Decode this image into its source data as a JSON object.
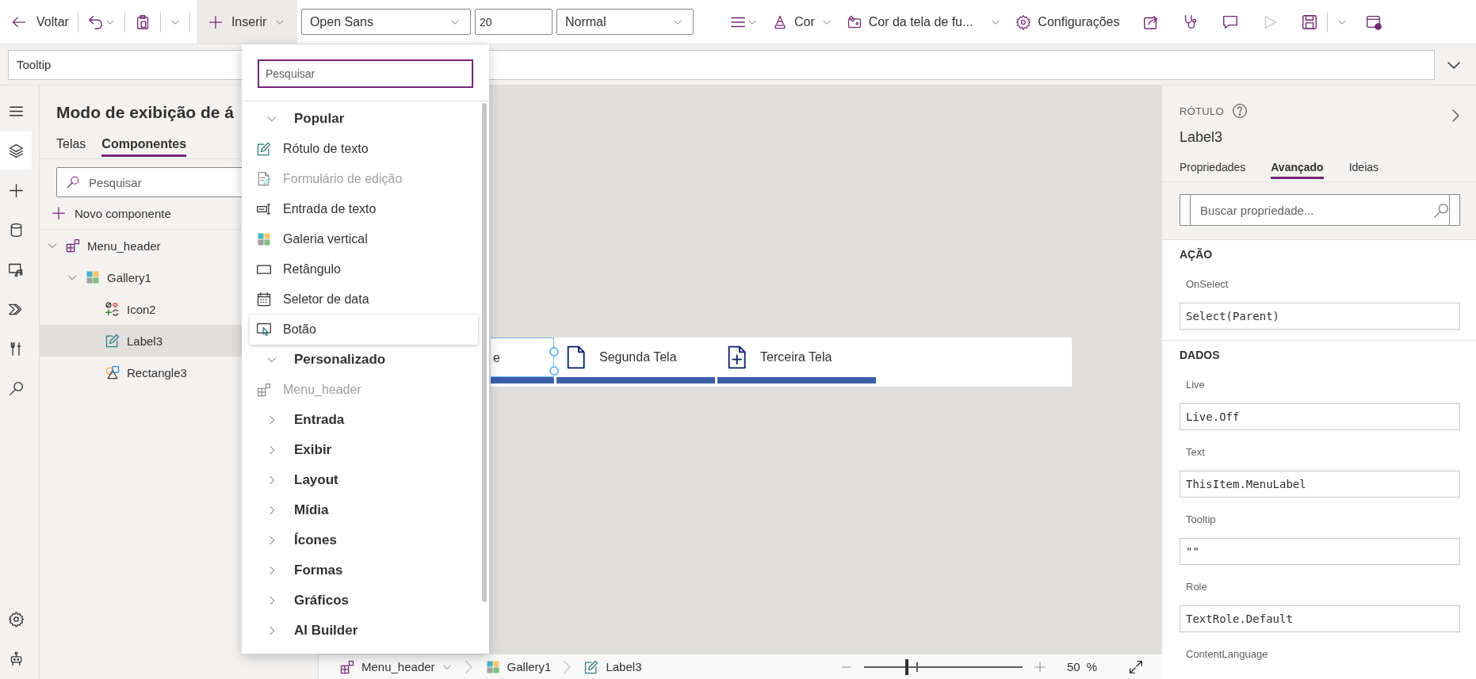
{
  "toolbar": {
    "back": "Voltar",
    "insert": {
      "label": "Inserir",
      "expanded": true
    },
    "font": "Open Sans",
    "size": "20",
    "weight": "Normal",
    "text_color_button": "Cor",
    "background_button": "Cor da tela de fu...",
    "settings": "Configurações",
    "play": {
      "disabled": true
    }
  },
  "formula_bar": {
    "property": "Tooltip"
  },
  "rail": {
    "top": [
      {
        "kind": "menu",
        "selected": false
      },
      {
        "kind": "layers",
        "selected": true
      },
      {
        "kind": "insert",
        "selected": false
      },
      {
        "kind": "data",
        "selected": false
      },
      {
        "kind": "media",
        "selected": false
      },
      {
        "kind": "automate",
        "selected": false
      },
      {
        "kind": "tools",
        "selected": false
      },
      {
        "kind": "search",
        "selected": false
      }
    ],
    "bottom": [
      {
        "kind": "settings",
        "selected": false
      },
      {
        "kind": "agent",
        "selected": false
      }
    ]
  },
  "tree_panel": {
    "title": "Modo de exibição de á",
    "tabs": [
      {
        "label": "Telas",
        "selected": false
      },
      {
        "label": "Componentes",
        "selected": true
      }
    ],
    "search_placeholder": "Pesquisar",
    "new_component": "Novo componente",
    "tree": [
      {
        "label": "Menu_header",
        "kind": "component",
        "expanded": true,
        "selected": false,
        "children": [
          {
            "label": "Gallery1",
            "kind": "gallery",
            "expanded": true,
            "selected": false,
            "children": [
              {
                "label": "Icon2",
                "kind": "icon",
                "selected": false
              },
              {
                "label": "Label3",
                "kind": "label",
                "selected": true
              },
              {
                "label": "Rectangle3",
                "kind": "rectangle",
                "selected": false
              }
            ]
          }
        ]
      }
    ]
  },
  "insert_menu": {
    "placeholder": "Pesquisar",
    "items": [
      {
        "kind": "group",
        "label": "Popular",
        "expanded": true
      },
      {
        "kind": "label",
        "label": "Rótulo de texto",
        "disabled": false,
        "hovered": false
      },
      {
        "kind": "form",
        "label": "Formulário de edição",
        "disabled": true,
        "hovered": false
      },
      {
        "kind": "textinput",
        "label": "Entrada de texto",
        "disabled": false,
        "hovered": false
      },
      {
        "kind": "gallery",
        "label": "Galeria vertical",
        "disabled": false,
        "hovered": false
      },
      {
        "kind": "rectangle",
        "label": "Retângulo",
        "disabled": false,
        "hovered": false
      },
      {
        "kind": "datepicker",
        "label": "Seletor de data",
        "disabled": false,
        "hovered": false
      },
      {
        "kind": "button",
        "label": "Botão",
        "disabled": false,
        "hovered": true
      },
      {
        "kind": "group",
        "label": "Personalizado",
        "expanded": true
      },
      {
        "kind": "component",
        "label": "Menu_header",
        "disabled": true,
        "hovered": false
      },
      {
        "kind": "group",
        "label": "Entrada",
        "expanded": false
      },
      {
        "kind": "group",
        "label": "Exibir",
        "expanded": false
      },
      {
        "kind": "group",
        "label": "Layout",
        "expanded": false
      },
      {
        "kind": "group",
        "label": "Mídia",
        "expanded": false
      },
      {
        "kind": "group",
        "label": "Ícones",
        "expanded": false
      },
      {
        "kind": "group",
        "label": "Formas",
        "expanded": false
      },
      {
        "kind": "group",
        "label": "Gráficos",
        "expanded": false
      },
      {
        "kind": "group",
        "label": "AI Builder",
        "expanded": false
      }
    ]
  },
  "canvas": {
    "items": [
      {
        "label": "e",
        "kind": "none",
        "selected": true
      },
      {
        "label": "Segunda Tela",
        "kind": "page",
        "selected": false
      },
      {
        "label": "Terceira Tela",
        "kind": "page-plus",
        "selected": false
      }
    ]
  },
  "properties": {
    "type": "RÓTULO",
    "name": "Label3",
    "tabs": [
      {
        "label": "Propriedades",
        "selected": false
      },
      {
        "label": "Avançado",
        "selected": true
      },
      {
        "label": "Ideias",
        "selected": false
      }
    ],
    "search_placeholder": "Buscar propriedade...",
    "sections": [
      {
        "title": "AÇÃO",
        "fields": [
          {
            "name": "OnSelect",
            "value": "Select(Parent)"
          }
        ]
      },
      {
        "title": "DADOS",
        "fields": [
          {
            "name": "Live",
            "value": "Live.Off"
          },
          {
            "name": "Text",
            "value": "ThisItem.MenuLabel"
          },
          {
            "name": "Tooltip",
            "value": "\"\""
          },
          {
            "name": "Role",
            "value": "TextRole.Default"
          },
          {
            "name": "ContentLanguage"
          }
        ]
      }
    ]
  },
  "status_bar": {
    "breadcrumb": [
      {
        "label": "Menu_header",
        "kind": "component",
        "dropdown": true
      },
      {
        "label": "Gallery1",
        "kind": "gallery",
        "dropdown": false
      },
      {
        "label": "Label3",
        "kind": "label",
        "dropdown": false
      }
    ],
    "zoom": {
      "level": 0.26,
      "value": "50",
      "unit": "%"
    }
  }
}
